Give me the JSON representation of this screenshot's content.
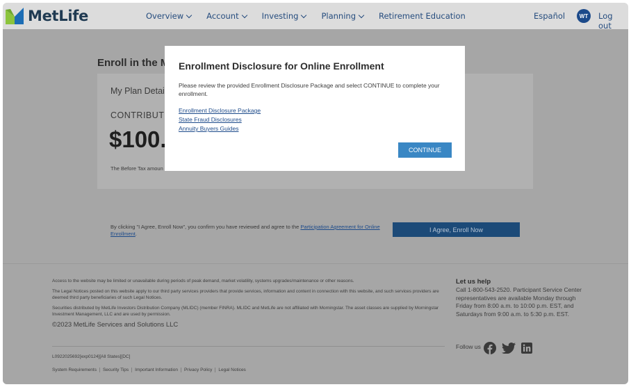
{
  "header": {
    "logo_text": "MetLife",
    "nav": [
      "Overview",
      "Account",
      "Investing",
      "Planning",
      "Retirement Education"
    ],
    "language": "Español",
    "avatar_initials": "WT",
    "logout": "Log out"
  },
  "main": {
    "enroll_title": "Enroll in the M",
    "plan_details": "My Plan Details",
    "contribution_label": "CONTRIBUTIO",
    "contribution_amount": "$100.",
    "before_tax_note": "The Before Tax amoun",
    "agree_text": "By clicking \"I Agree, Enroll Now\", you confirm you have reviewed and agree to the ",
    "agree_link": "Participation Agreement for Online Enrollment",
    "agree_end": ".",
    "enroll_button": "I Agree, Enroll Now"
  },
  "modal": {
    "title": "Enrollment Disclosure for Online Enrollment",
    "body": "Please review the provided Enrollment Disclosure Package and select CONTINUE to complete your enrollment.",
    "links": [
      "Enrollment Disclosure Package",
      "State Fraud Disclosures",
      "Annuity Buyers Guides"
    ],
    "continue_button": "CONTINUE"
  },
  "footer": {
    "notice_1": "Access to the website may be limited or unavailable during periods of peak demand, market volatility, systems upgrades/maintenance or other reasons.",
    "notice_2": "The Legal Notices posted on this website apply to our third party services providers that provide services, information and content in connection with this website, and such services providers are deemed third party beneficiaries of such Legal Notices.",
    "notice_3": "Securities distributed by MetLife Investors Distribution Company (MLIDC) (member FINRA). MLIDC and MetLife are not affiliated with Morningstar. The asset classes are supplied by Morningstar Investment Management, LLC and are used by permission.",
    "copyright": "©2023 MetLife Services and Solutions LLC",
    "code": "L0922025692[exp0124][All States][DC]",
    "links": [
      "System Requirements",
      "Security Tips",
      "Important Information",
      "Privacy Policy",
      "Legal Notices"
    ],
    "help_title": "Let us help",
    "help_body": "Call 1-800-543-2520. Participant Service Center representatives are available Monday through Friday from 8:00 a.m. to 10:00 p.m. EST, and Saturdays from 9:00 a.m. to 5:30 p.m. EST.",
    "follow_label": "Follow us",
    "social_icons": [
      "facebook-icon",
      "twitter-icon",
      "linkedin-icon"
    ]
  },
  "colors": {
    "brand_blue": "#254c7e",
    "logo_green": "#8cc43c",
    "logo_blue": "#1c6db5",
    "continue_button": "#3a87c4",
    "overlay": "#a6a6a6"
  }
}
